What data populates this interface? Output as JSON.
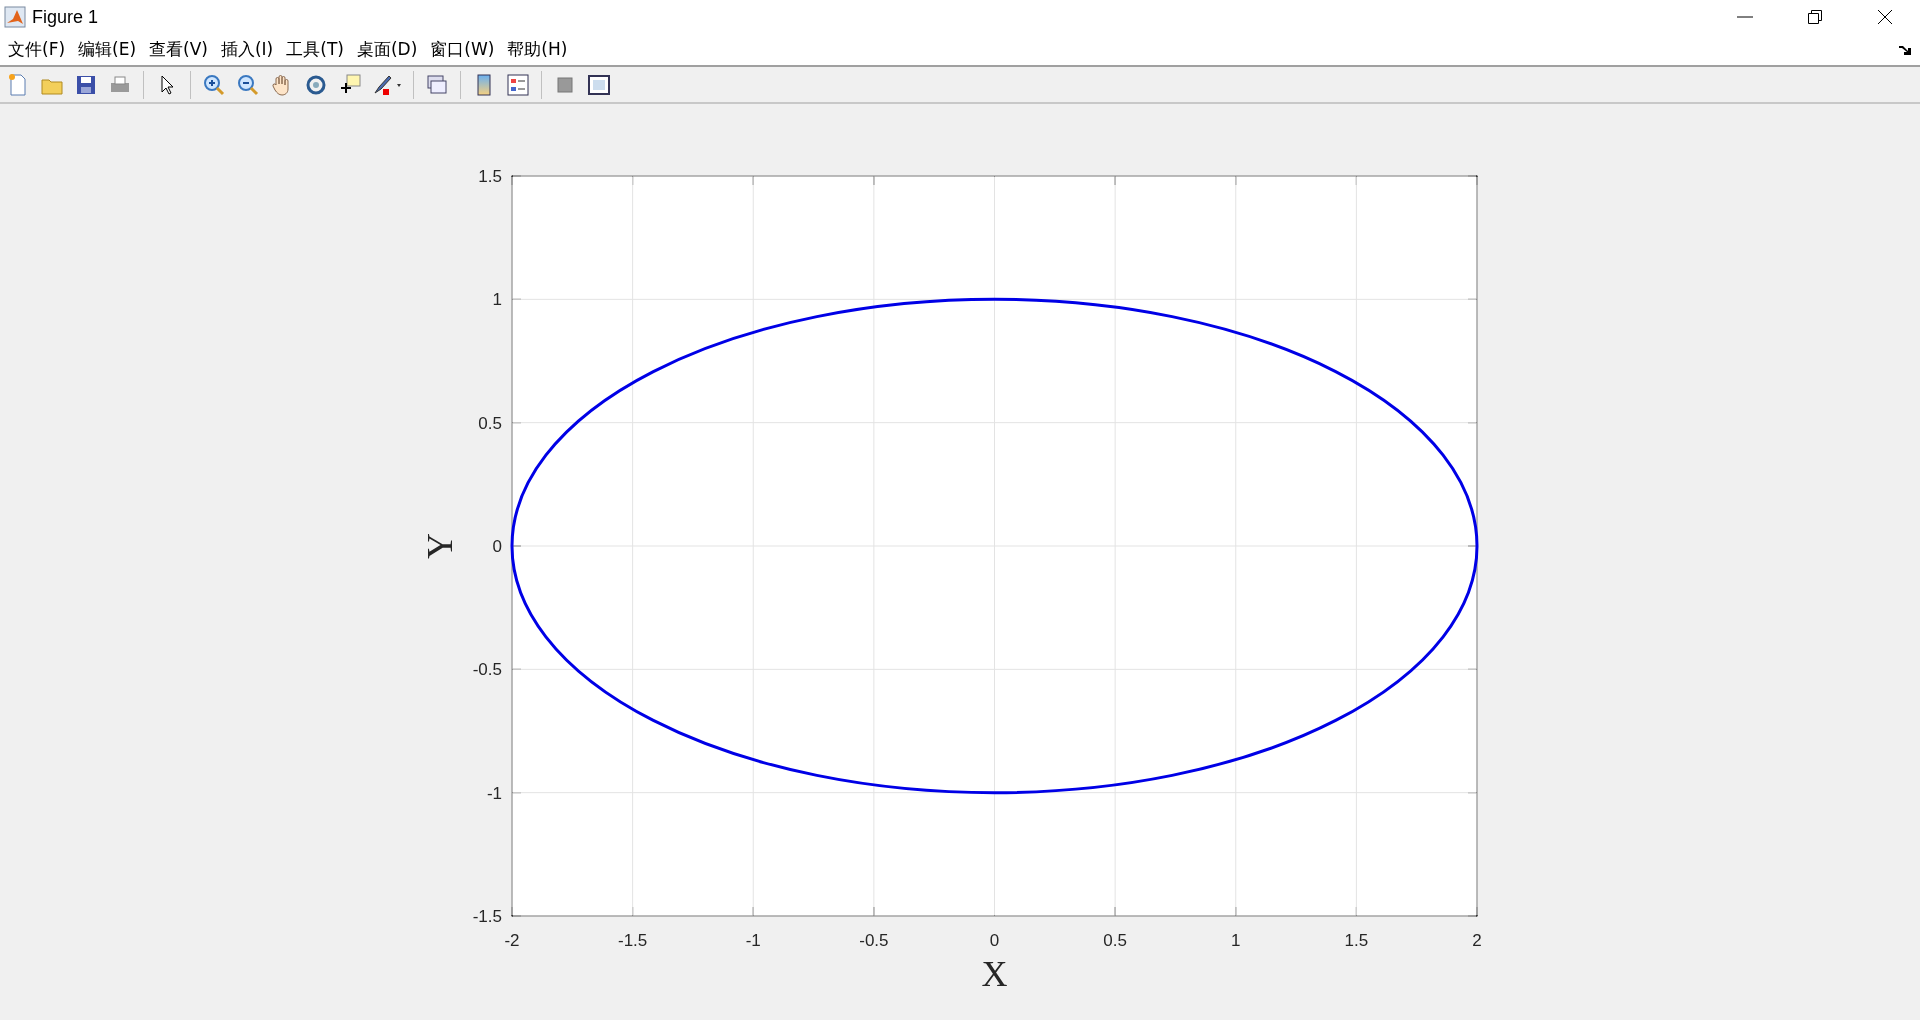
{
  "window": {
    "title": "Figure 1"
  },
  "menu": [
    "文件(F)",
    "编辑(E)",
    "查看(V)",
    "插入(I)",
    "工具(T)",
    "桌面(D)",
    "窗口(W)",
    "帮助(H)"
  ],
  "toolbar": [
    {
      "kind": "new"
    },
    {
      "kind": "open"
    },
    {
      "kind": "save"
    },
    {
      "kind": "print"
    },
    {
      "kind": "sep"
    },
    {
      "kind": "pointer"
    },
    {
      "kind": "sep"
    },
    {
      "kind": "zoom-in"
    },
    {
      "kind": "zoom-out"
    },
    {
      "kind": "pan"
    },
    {
      "kind": "rotate"
    },
    {
      "kind": "datatip"
    },
    {
      "kind": "brush"
    },
    {
      "kind": "sep"
    },
    {
      "kind": "link"
    },
    {
      "kind": "sep"
    },
    {
      "kind": "colorbar"
    },
    {
      "kind": "legend"
    },
    {
      "kind": "sep"
    },
    {
      "kind": "hide"
    },
    {
      "kind": "show"
    }
  ],
  "figure": {
    "chart_data": {
      "type": "line",
      "xlabel": "X",
      "ylabel": "Y",
      "grid": true,
      "xlim": [
        -2,
        2
      ],
      "ylim": [
        -1.5,
        1.5
      ],
      "xticks": [
        -2,
        -1.5,
        -1,
        -0.5,
        0,
        0.5,
        1,
        1.5,
        2
      ],
      "yticks": [
        -1.5,
        -1,
        -0.5,
        0,
        0.5,
        1,
        1.5
      ]
    }
  }
}
